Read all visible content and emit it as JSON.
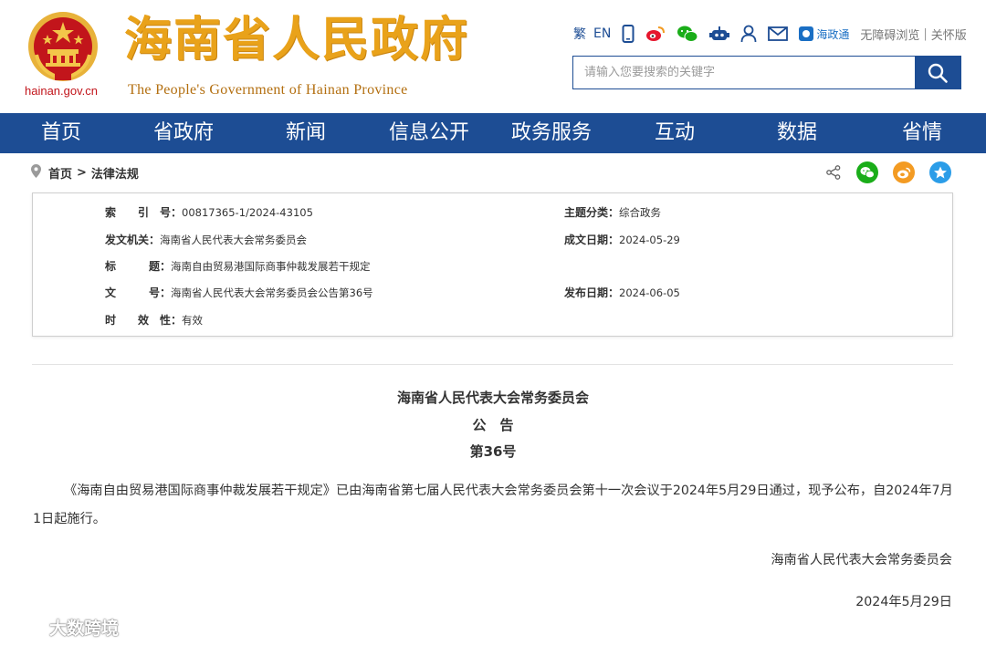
{
  "header": {
    "site_title": "海南省人民政府",
    "site_subtitle": "The People's Government  of Hainan Province",
    "domain": "hainan.gov.cn",
    "tools": {
      "traditional": "繁",
      "english": "EN",
      "hzt": "海政通",
      "accessible": "无障碍浏览",
      "elder": "关怀版"
    },
    "search_placeholder": "请输入您要搜索的关键字"
  },
  "nav": {
    "items": [
      {
        "label": "首页"
      },
      {
        "label": "省政府"
      },
      {
        "label": "新闻"
      },
      {
        "label": "信息公开"
      },
      {
        "label": "政务服务"
      },
      {
        "label": "互动"
      },
      {
        "label": "数据"
      },
      {
        "label": "省情"
      }
    ]
  },
  "breadcrumb": {
    "home": "首页",
    "current": "法律法规"
  },
  "info": {
    "index_label": "索　　引　号：",
    "index_value": "00817365-1/2024-43105",
    "category_label": "主题分类：",
    "category_value": "综合政务",
    "issuer_label": "发文机关：",
    "issuer_value": "海南省人民代表大会常务委员会",
    "created_label": "成文日期：",
    "created_value": "2024-05-29",
    "title_label": "标　　　题：",
    "title_value": "海南自由贸易港国际商事仲裁发展若干规定",
    "docno_label": "文　　　号：",
    "docno_value": "海南省人民代表大会常务委员会公告第36号",
    "published_label": "发布日期：",
    "published_value": "2024-06-05",
    "validity_label": "时　　效　性：",
    "validity_value": "有效"
  },
  "document": {
    "heading1": "海南省人民代表大会常务委员会",
    "heading2": "公　告",
    "heading3": "第36号",
    "paragraph": "《海南自由贸易港国际商事仲裁发展若干规定》已由海南省第七届人民代表大会常务委员会第十一次会议于2024年5月29日通过，现予公布，自2024年7月1日起施行。",
    "signature": "海南省人民代表大会常务委员会",
    "date": "2024年5月29日"
  },
  "watermark": {
    "text": "大数跨境"
  },
  "colors": {
    "primary": "#1d4d94",
    "title_gold": "#e9a21a",
    "emblem_red": "#c2151b",
    "wechat": "#1aad19",
    "weibo": "#f39b23",
    "qzone": "#2b9de8"
  }
}
